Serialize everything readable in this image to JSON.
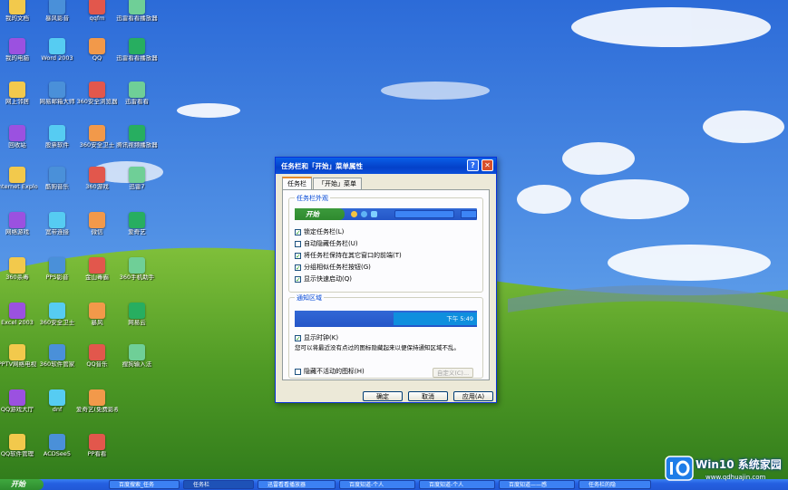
{
  "desktop": {
    "icons": [
      [
        "我的文档",
        "暴风影音",
        "qqfm",
        "迅雷看看播放器"
      ],
      [
        "我的电脑",
        "Word 2003",
        "QQ",
        "迅雷看看播放器"
      ],
      [
        "网上邻居",
        "网易邮箱大师",
        "360安全浏览器",
        "迅雷看看"
      ],
      [
        "回收站",
        "股票软件",
        "360安全卫士",
        "腾讯视频播放器"
      ],
      [
        "Internet Explorer",
        "酷狗音乐",
        "360游戏",
        "迅雷7"
      ],
      [
        "网络游戏",
        "宽带连接",
        "微信",
        "爱奇艺"
      ],
      [
        "360杀毒",
        "PPS影音",
        "金山毒霸",
        "360手机助手"
      ],
      [
        "Excel 2003",
        "360安全卫士",
        "暴风",
        "网易云"
      ],
      [
        "PPTV网络电视",
        "360软件管家",
        "QQ音乐",
        "搜狗输入法"
      ],
      [
        "QQ游戏大厅",
        "dnf",
        "爱奇艺(免费影视大全)"
      ],
      [
        "QQ软件管理",
        "ACDSee5",
        "PP看看"
      ]
    ]
  },
  "dialog": {
    "title": "任务栏和「开始」菜单属性",
    "tabs": [
      "任务栏",
      "「开始」菜单"
    ],
    "group1_title": "任务栏外观",
    "start_label": "开始",
    "options1": [
      {
        "label": "锁定任务栏(L)",
        "checked": true
      },
      {
        "label": "自动隐藏任务栏(U)",
        "checked": false
      },
      {
        "label": "将任务栏保持在其它窗口的前端(T)",
        "checked": true
      },
      {
        "label": "分组相似任务栏按钮(G)",
        "checked": true
      },
      {
        "label": "显示快速启动(Q)",
        "checked": true
      }
    ],
    "group2_title": "通知区域",
    "tray_time": "下午 5:49",
    "show_clock": "显示时钟(K)",
    "note": "您可以将最近没有点过的图标隐藏起来以便保持通知区域不乱。",
    "hide_inactive": "隐藏不活动的图标(H)",
    "customize": "自定义(C)...",
    "ok": "确定",
    "cancel": "取消",
    "apply": "应用(A)"
  },
  "taskbar": {
    "start": "开始",
    "tasks": [
      "百度搜索_任务",
      "任务栏",
      "迅雷看看播放器",
      "百度知道-个人",
      "百度知道-个人",
      "百度知道——感",
      "任务栏的隐"
    ]
  },
  "watermark": {
    "title": "Win10 系统家园",
    "url": "www.qdhuajin.com"
  }
}
